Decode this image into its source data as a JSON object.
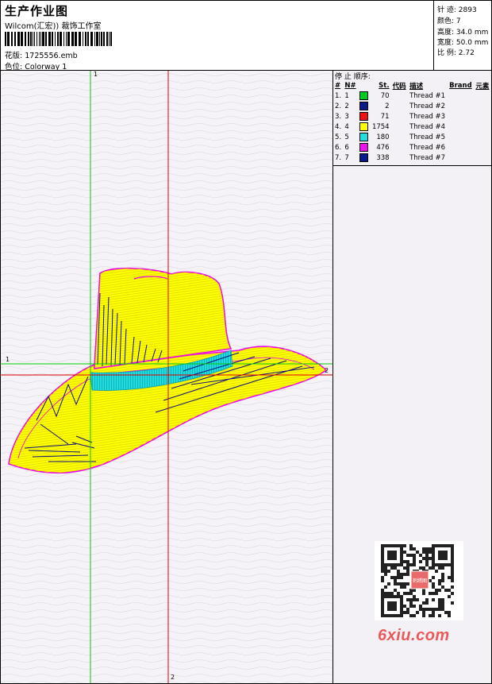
{
  "header": {
    "title": "生产作业图",
    "vendor": "Wilcom(汇宏)) 裁饰工作室",
    "file_label": "花版:",
    "file_value": "1725556.emb",
    "colorway_label": "色位:",
    "colorway_value": "Colorway 1"
  },
  "stats": [
    {
      "label": "针 迹:",
      "value": "2893"
    },
    {
      "label": "颜色:",
      "value": "7"
    },
    {
      "label": "高度:",
      "value": "34.0 mm"
    },
    {
      "label": "宽度:",
      "value": "50.0 mm"
    },
    {
      "label": "比 例:",
      "value": "2.72"
    }
  ],
  "canvas": {
    "guide_green_v": "1",
    "guide_green_h": "1",
    "guide_red_h": "2",
    "guide_red_v": "2",
    "colors": {
      "green": "#00cc00",
      "red": "#dd0000",
      "hat_fill": "#ffff00",
      "band": "#22dddd",
      "outline": "#ee00ee",
      "stitch_dark": "#101080"
    }
  },
  "panel": {
    "stop_sequence_label": "停 止 顺序:",
    "columns": [
      "#",
      "N#",
      "St.",
      "代码",
      "描述",
      "Brand",
      "元素"
    ],
    "threads": [
      {
        "index": "1.",
        "n": "1",
        "color": "#00cc22",
        "stitches": "70",
        "desc": "Thread #1"
      },
      {
        "index": "2.",
        "n": "2",
        "color": "#0a1a8a",
        "stitches": "2",
        "desc": "Thread #2"
      },
      {
        "index": "3.",
        "n": "3",
        "color": "#ee1111",
        "stitches": "71",
        "desc": "Thread #3"
      },
      {
        "index": "4.",
        "n": "4",
        "color": "#ffff00",
        "stitches": "1754",
        "desc": "Thread #4"
      },
      {
        "index": "5.",
        "n": "5",
        "color": "#22dddd",
        "stitches": "180",
        "desc": "Thread #5"
      },
      {
        "index": "6.",
        "n": "6",
        "color": "#ee11ee",
        "stitches": "476",
        "desc": "Thread #6"
      },
      {
        "index": "7.",
        "n": "7",
        "color": "#0a1a8a",
        "stitches": "338",
        "desc": "Thread #7"
      }
    ],
    "qr_badge": "刺绣图",
    "watermark": "6xiu.com"
  }
}
